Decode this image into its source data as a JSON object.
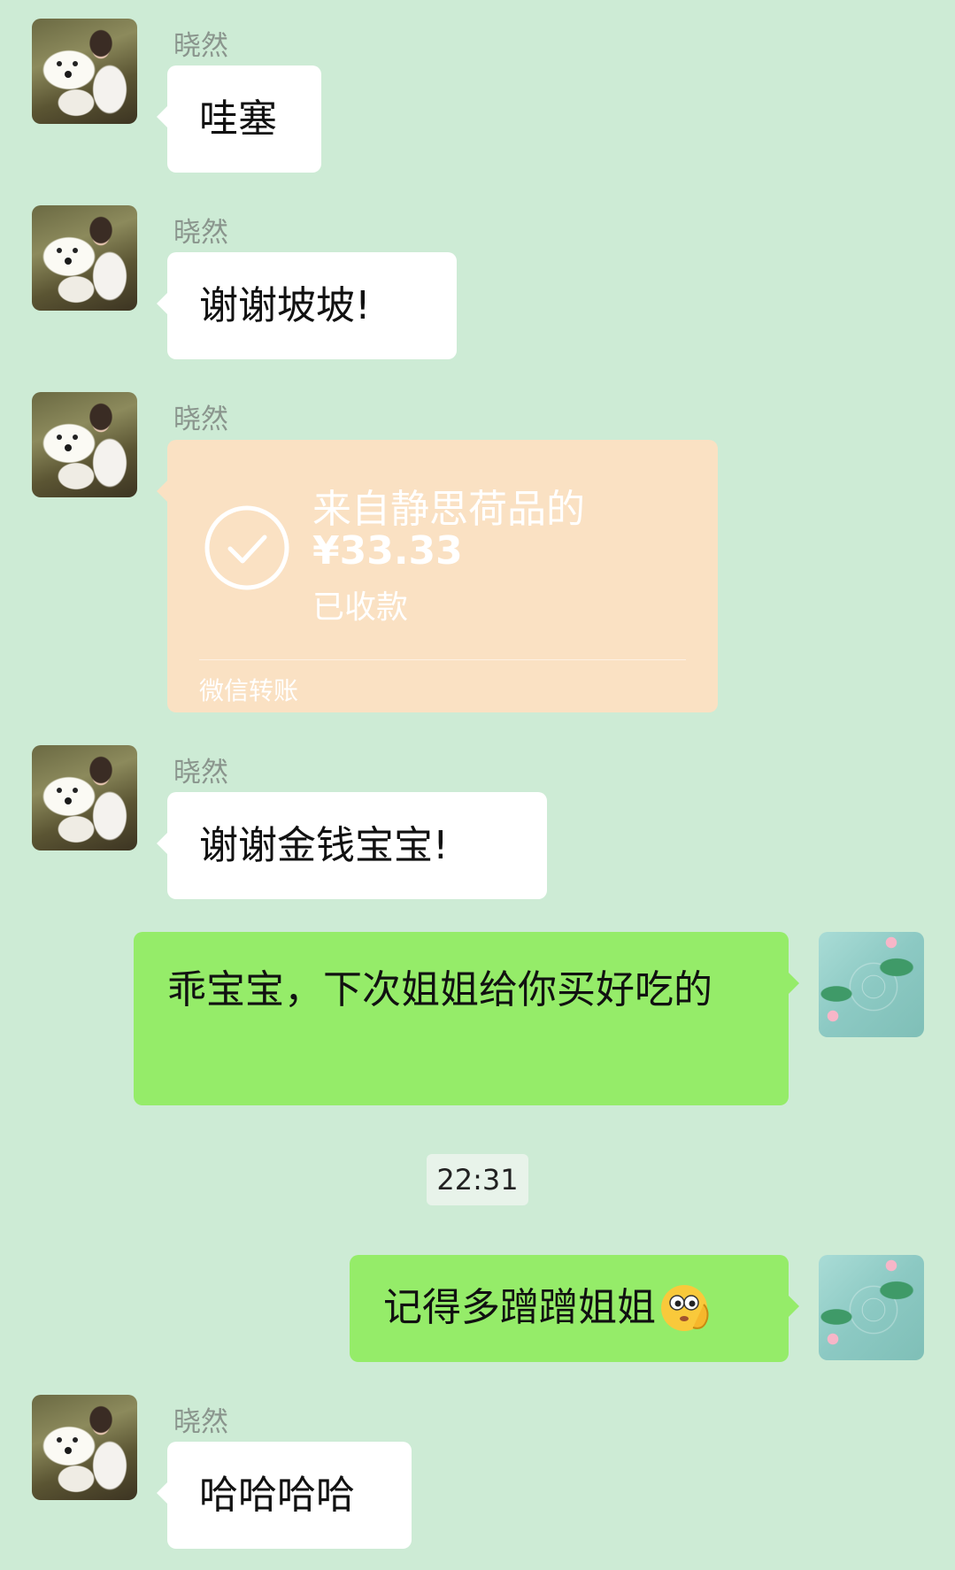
{
  "sender_name": "晓然",
  "messages": [
    {
      "text": "哇塞"
    },
    {
      "text": "谢谢坡坡!"
    },
    {
      "text": "谢谢金钱宝宝!"
    },
    {
      "text": "乖宝宝，下次姐姐给你买好吃的"
    },
    {
      "text": "记得多蹭蹭姐姐"
    },
    {
      "text": "哈哈哈哈"
    }
  ],
  "transfer": {
    "title": "来自静思荷品的",
    "amount": "¥33.33",
    "status": "已收款",
    "footer": "微信转账"
  },
  "timestamp": "22:31",
  "colors": {
    "background": "#cdebd5",
    "self_bubble": "#95ec69",
    "other_bubble": "#ffffff",
    "transfer_card": "#fae1c3"
  },
  "icons": {
    "transfer_status": "check-circle-icon",
    "emoji": "thinking-face-emoji"
  }
}
